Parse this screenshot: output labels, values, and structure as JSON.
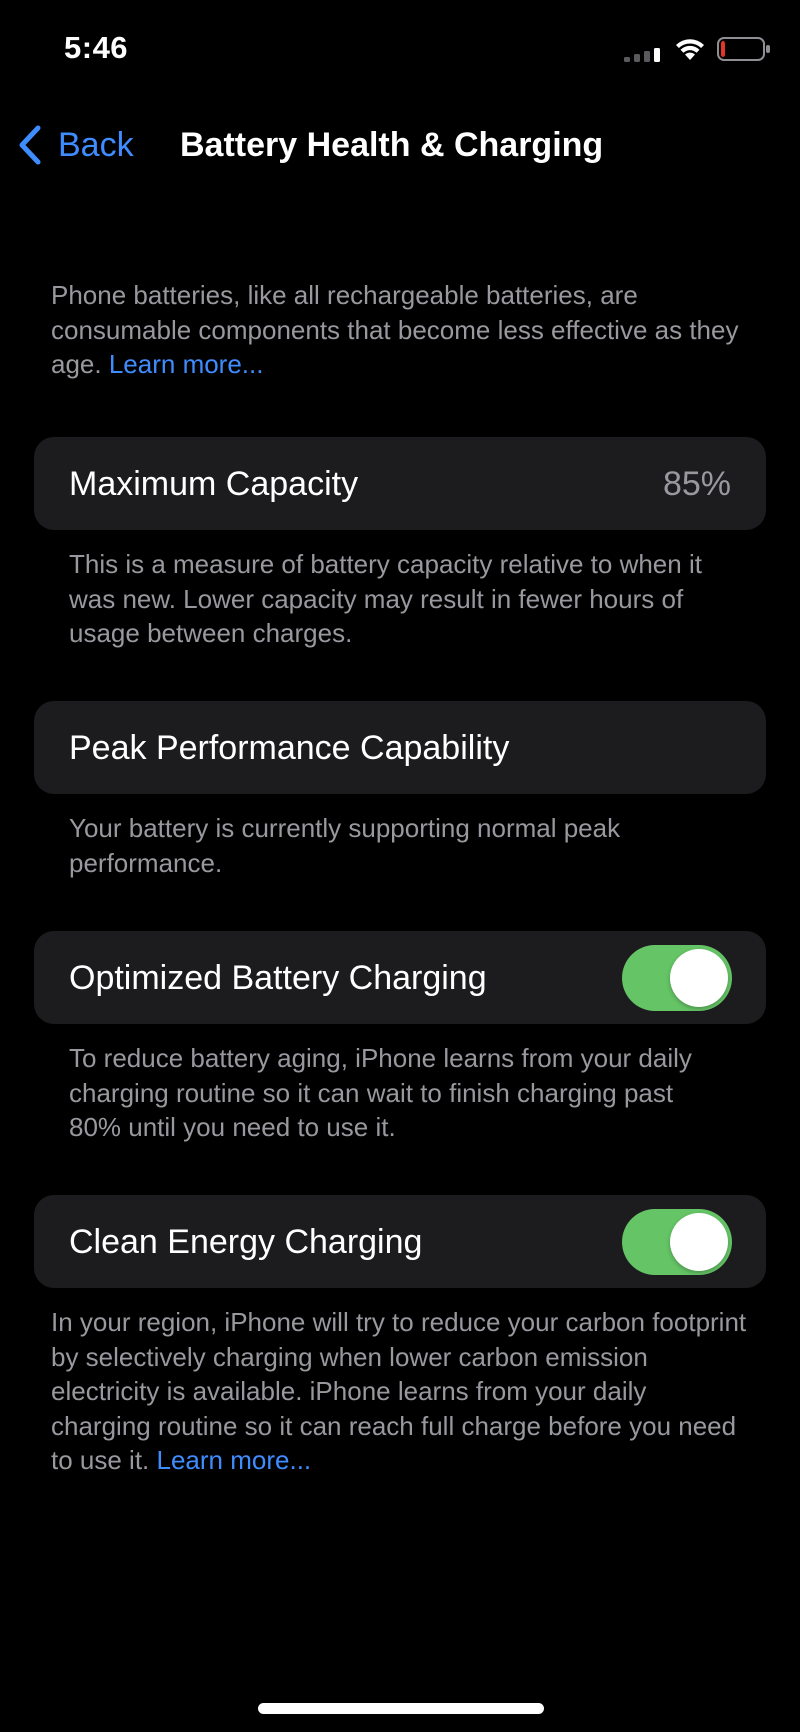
{
  "status_bar": {
    "time": "5:46",
    "signal_icon": "cellular-signal-icon",
    "wifi_icon": "wifi-icon",
    "battery_icon": "battery-low-icon",
    "battery_level_fraction": 0.1,
    "battery_color": "#e5352b"
  },
  "nav": {
    "back_label": "Back",
    "title": "Battery Health & Charging"
  },
  "intro": {
    "text": "Phone batteries, like all rechargeable batteries, are consumable components that become less effective as they age.",
    "link": "Learn more..."
  },
  "max_capacity": {
    "label": "Maximum Capacity",
    "value": "85%",
    "footnote": "This is a measure of battery capacity relative to when it was new. Lower capacity may result in fewer hours of usage between charges."
  },
  "peak_performance": {
    "label": "Peak Performance Capability",
    "footnote": "Your battery is currently supporting normal peak performance."
  },
  "optimized_charging": {
    "label": "Optimized Battery Charging",
    "enabled": true,
    "footnote": "To reduce battery aging, iPhone learns from your daily charging routine so it can wait to finish charging past 80% until you need to use it."
  },
  "clean_energy": {
    "label": "Clean Energy Charging",
    "enabled": true,
    "footnote": "In your region, iPhone will try to reduce your carbon footprint by selectively charging when lower carbon emission electricity is available. iPhone learns from your daily charging routine so it can reach full charge before you need to use it.",
    "link": "Learn more..."
  },
  "colors": {
    "accent_blue": "#3f8cff",
    "toggle_on": "#65c466",
    "card_bg": "#1c1c1e",
    "secondary_text": "#98989e"
  }
}
